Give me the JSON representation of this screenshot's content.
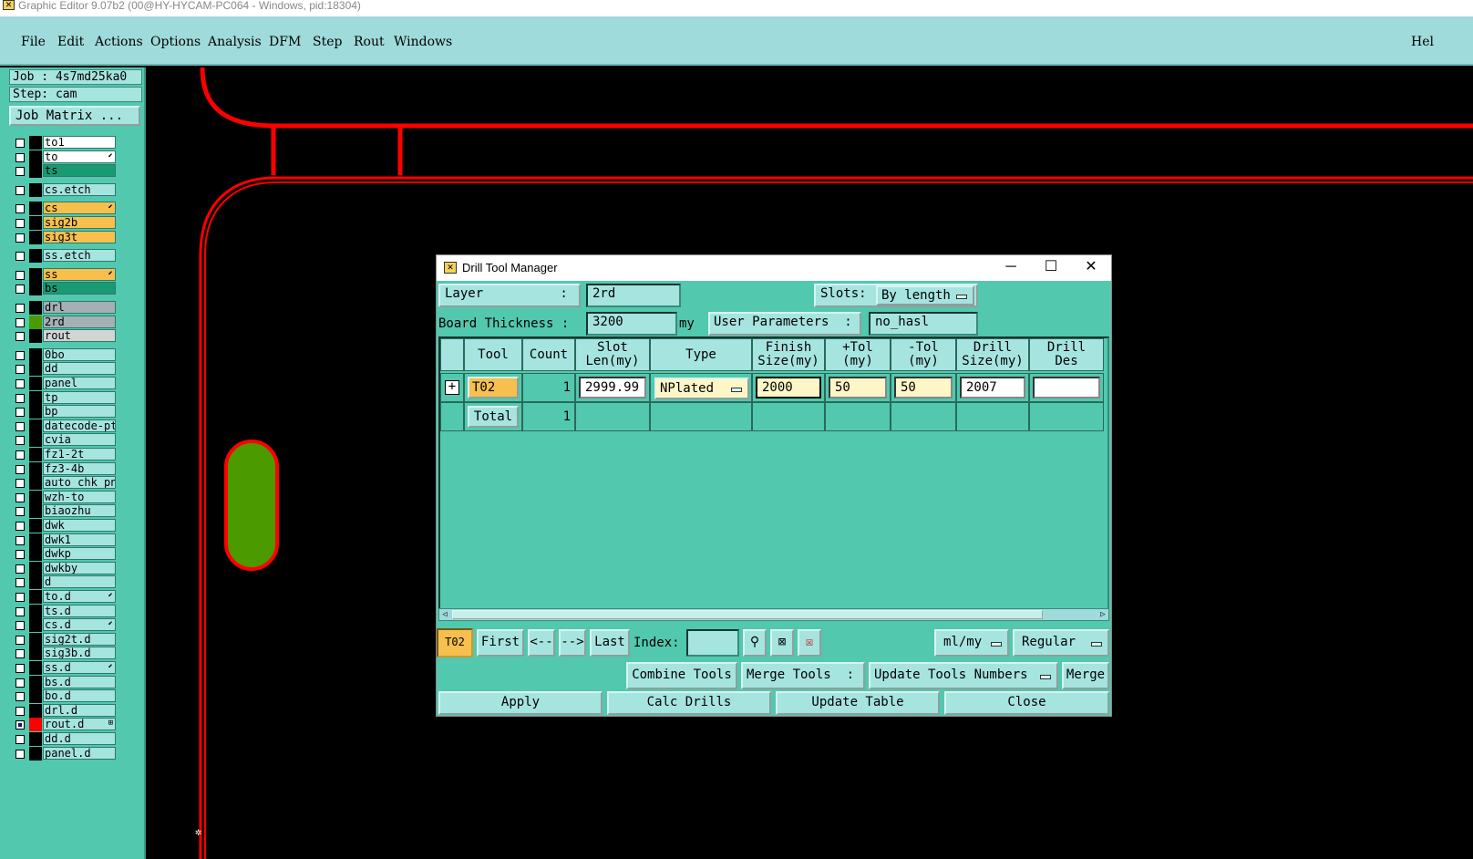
{
  "titlebar": {
    "title": "Graphic Editor 9.07b2 (00@HY-HYCAM-PC064 - Windows, pid:18304)"
  },
  "menu": {
    "items": [
      "File",
      "Edit",
      "Actions",
      "Options",
      "Analysis",
      "DFM",
      "Step",
      "Rout",
      "Windows"
    ],
    "help": "Hel"
  },
  "left": {
    "job": "Job : 4s7md25ka0",
    "step": "Step: cam",
    "job_matrix": "Job Matrix ...",
    "layers": [
      {
        "name": "to1",
        "bg": "#ffffff",
        "mark": ""
      },
      {
        "name": "to",
        "bg": "#ffffff",
        "mark": "⬋"
      },
      {
        "name": "ts",
        "bg": "#1a9a72",
        "mark": ""
      },
      {
        "name": "cs.etch",
        "bg": "#a6e4e0",
        "mark": ""
      },
      {
        "name": "cs",
        "bg": "#f7bf4e",
        "mark": "⬋"
      },
      {
        "name": "sig2b",
        "bg": "#f7bf4e",
        "mark": ""
      },
      {
        "name": "sig3t",
        "bg": "#f7bf4e",
        "mark": ""
      },
      {
        "name": "ss.etch",
        "bg": "#a6e4e0",
        "mark": ""
      },
      {
        "name": "ss",
        "bg": "#f7bf4e",
        "mark": "⬋"
      },
      {
        "name": "bs",
        "bg": "#1a9a72",
        "mark": ""
      },
      {
        "name": "drl",
        "bg": "#a4b0b4",
        "mark": ""
      },
      {
        "name": "2rd",
        "bg": "#a4b0b4",
        "mark": ""
      },
      {
        "name": "rout",
        "bg": "#d4d4d4",
        "mark": ""
      },
      {
        "name": "0bo",
        "bg": "#a6e4e0",
        "mark": ""
      },
      {
        "name": "dd",
        "bg": "#a6e4e0",
        "mark": ""
      },
      {
        "name": "panel",
        "bg": "#a6e4e0",
        "mark": ""
      },
      {
        "name": "tp",
        "bg": "#a6e4e0",
        "mark": ""
      },
      {
        "name": "bp",
        "bg": "#a6e4e0",
        "mark": ""
      },
      {
        "name": "datecode-pte",
        "bg": "#a6e4e0",
        "mark": ""
      },
      {
        "name": "cvia",
        "bg": "#a6e4e0",
        "mark": ""
      },
      {
        "name": "fz1-2t",
        "bg": "#a6e4e0",
        "mark": ""
      },
      {
        "name": "fz3-4b",
        "bg": "#a6e4e0",
        "mark": ""
      },
      {
        "name": "auto_chk_pnl",
        "bg": "#a6e4e0",
        "mark": ""
      },
      {
        "name": "wzh-to",
        "bg": "#a6e4e0",
        "mark": ""
      },
      {
        "name": "biaozhu",
        "bg": "#a6e4e0",
        "mark": ""
      },
      {
        "name": "dwk",
        "bg": "#a6e4e0",
        "mark": ""
      },
      {
        "name": "dwk1",
        "bg": "#a6e4e0",
        "mark": ""
      },
      {
        "name": "dwkp",
        "bg": "#a6e4e0",
        "mark": ""
      },
      {
        "name": "dwkby",
        "bg": "#a6e4e0",
        "mark": ""
      },
      {
        "name": "d",
        "bg": "#a6e4e0",
        "mark": ""
      },
      {
        "name": "to.d",
        "bg": "#a6e4e0",
        "mark": "⬋"
      },
      {
        "name": "ts.d",
        "bg": "#a6e4e0",
        "mark": ""
      },
      {
        "name": "cs.d",
        "bg": "#a6e4e0",
        "mark": "⬋"
      },
      {
        "name": "sig2t.d",
        "bg": "#a6e4e0",
        "mark": ""
      },
      {
        "name": "sig3b.d",
        "bg": "#a6e4e0",
        "mark": ""
      },
      {
        "name": "ss.d",
        "bg": "#a6e4e0",
        "mark": "⬋"
      },
      {
        "name": "bs.d",
        "bg": "#a6e4e0",
        "mark": ""
      },
      {
        "name": "bo.d",
        "bg": "#a6e4e0",
        "mark": ""
      },
      {
        "name": "drl.d",
        "bg": "#a6e4e0",
        "mark": ""
      },
      {
        "name": "rout.d",
        "bg": "#a6e4e0",
        "mark": "⊞"
      },
      {
        "name": "dd.d",
        "bg": "#a6e4e0",
        "mark": ""
      },
      {
        "name": "panel.d",
        "bg": "#a6e4e0",
        "mark": ""
      }
    ]
  },
  "dialog": {
    "title": "Drill Tool Manager",
    "layer_label": "Layer          :",
    "layer_value": "2rd",
    "slots_label": "Slots:",
    "slots_value": "By length",
    "board_label": "Board Thickness :",
    "board_value": "3200",
    "board_unit": "my",
    "user_params_label": "User Parameters  :",
    "user_params_value": "no_hasl",
    "columns": [
      "Tool",
      "Count",
      "Slot\nLen(my)",
      "Type",
      "Finish\nSize(my)",
      "+Tol\n(my)",
      "-Tol\n(my)",
      "Drill\nSize(my)",
      "Drill\nDes"
    ],
    "row": {
      "tool": "T02",
      "count": "1",
      "slot_len": "2999.99",
      "type": "NPlated",
      "finish": "2000",
      "ptol": "50",
      "ntol": "50",
      "drill_size": "2007",
      "drill_des": ""
    },
    "total": {
      "label": "Total",
      "count": "1"
    },
    "nav": {
      "current": "T02",
      "first": "First",
      "prev": "<--",
      "next": "-->",
      "last": "Last",
      "index_label": "Index:",
      "units": "ml/my",
      "mode": "Regular"
    },
    "actions": {
      "combine": "Combine Tools",
      "merge_label": "Merge Tools  :",
      "update_numbers": "Update Tools Numbers",
      "merge": "Merge"
    },
    "bottom": {
      "apply": "Apply",
      "calc": "Calc Drills",
      "update": "Update Table",
      "close": "Close"
    }
  },
  "colors": {
    "accent": "#52c8ae",
    "panel_light": "#a6e4e0",
    "outline_red": "#ff0000",
    "pad_green": "#4a9a00"
  }
}
